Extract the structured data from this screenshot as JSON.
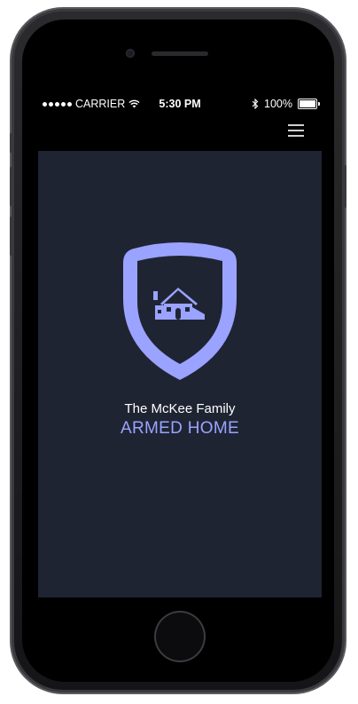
{
  "status_bar": {
    "carrier": "CARRIER",
    "time": "5:30 PM",
    "battery": "100%",
    "wifi_icon": "wifi-icon",
    "bluetooth_icon": "bluetooth-icon",
    "battery_icon": "battery-icon",
    "battery_level": 1.0
  },
  "header": {
    "menu_icon": "hamburger-menu-icon"
  },
  "main": {
    "logo_icon": "shield-home-icon",
    "family_name": "The McKee Family",
    "status": "ARMED HOME"
  },
  "colors": {
    "background": "#1f2433",
    "accent": "#9aa3ff",
    "text": "#ffffff"
  }
}
